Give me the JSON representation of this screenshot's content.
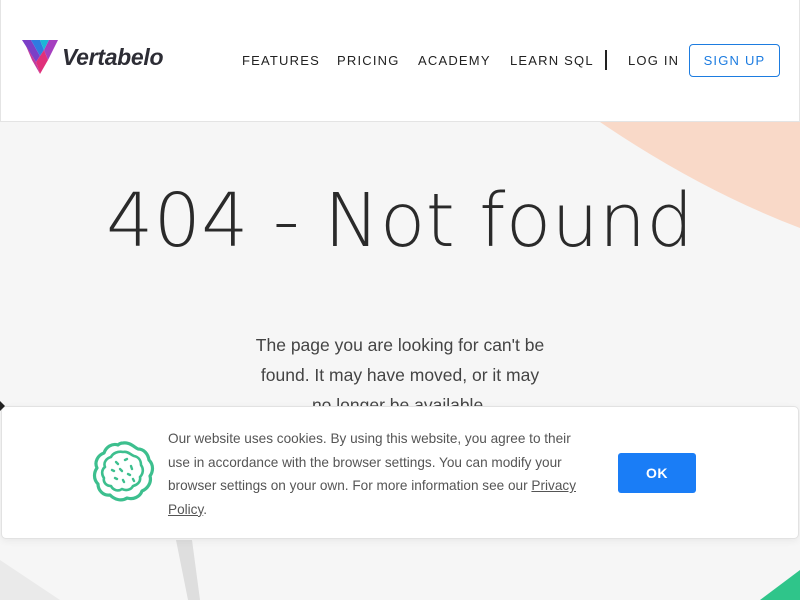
{
  "header": {
    "brand": "Vertabelo",
    "nav": {
      "features": "FEATURES",
      "pricing": "PRICING",
      "academy": "ACADEMY",
      "learn_sql": "LEARN SQL",
      "login": "LOG IN",
      "signup": "SIGN UP"
    }
  },
  "main": {
    "title": "404 - Not found",
    "message": "The page you are looking for can't be found. It may have moved, or it may no longer be available."
  },
  "cookie_banner": {
    "text": "Our website uses cookies. By using this website, you agree to their use in accordance with the browser settings. You can modify your browser settings on your own. For more information see our",
    "link": "Privacy Policy",
    "trailing": ".",
    "ok_label": "OK"
  },
  "colors": {
    "accent": "#1a7df6",
    "signup_border": "#1d7ce0",
    "peach_deco": "#f9d9c8",
    "green_deco": "#2fc58a",
    "cookie_icon": "#3dbf8e"
  },
  "icons": {
    "logo": "vertabelo-logo-mark",
    "cookie": "cookie-icon"
  }
}
